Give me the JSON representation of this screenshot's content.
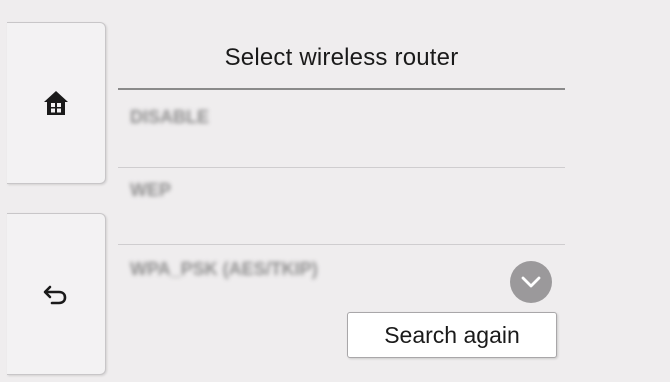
{
  "screen": {
    "title": "Select wireless router"
  },
  "router_list": {
    "items": [
      {
        "label": "DISABLE"
      },
      {
        "label": "WEP"
      },
      {
        "label": "WPA_PSK (AES/TKIP)"
      }
    ]
  },
  "buttons": {
    "search_again": "Search again"
  },
  "icons": {
    "home": "home-icon",
    "back": "back-arrow-icon",
    "scroll": "chevron-down-icon"
  }
}
